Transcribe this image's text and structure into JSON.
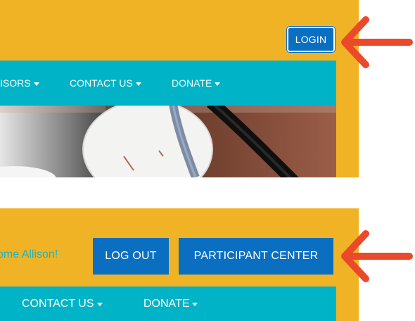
{
  "top_panel": {
    "login_label": "LOGIN",
    "nav": [
      {
        "label": "ISORS"
      },
      {
        "label": "CONTACT US"
      },
      {
        "label": "DONATE"
      }
    ]
  },
  "bottom_panel": {
    "welcome_text": "ome Allison!",
    "logout_label": "LOG OUT",
    "participant_center_label": "PARTICIPANT CENTER",
    "nav": [
      {
        "label": "CONTACT US"
      },
      {
        "label": "DONATE"
      }
    ]
  },
  "colors": {
    "header_bg": "#f0b325",
    "nav_bg": "#00b3c6",
    "button_bg": "#0b6fc1",
    "arrow": "#ea4a2a",
    "welcome_text": "#17b6c6"
  },
  "icons": [
    "chevron-down-icon",
    "arrow-left-icon"
  ]
}
